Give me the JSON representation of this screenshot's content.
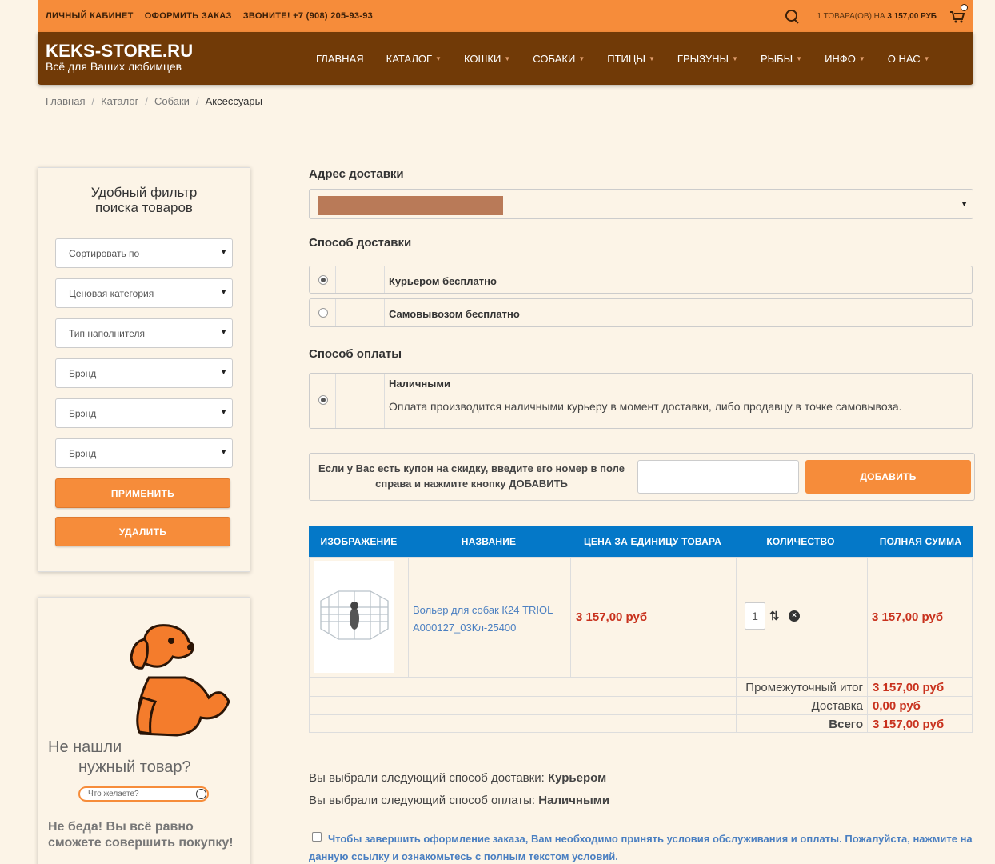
{
  "topbar": {
    "account": "Личный кабинет",
    "checkout": "Оформить заказ",
    "phone": "Звоните! +7 (908) 205-93-93",
    "cart_prefix": "1 ТОВАРА(ОВ) НА",
    "cart_total": "3 157,00 РУБ"
  },
  "header": {
    "logo": "KEKS-STORE.RU",
    "slogan": "Всё для Ваших любимцев",
    "menu": [
      "Главная",
      "Каталог",
      "Кошки",
      "Собаки",
      "Птицы",
      "Грызуны",
      "Рыбы",
      "Инфо",
      "О нас"
    ]
  },
  "breadcrumb": [
    "Главная",
    "Каталог",
    "Собаки",
    "Аксессуары"
  ],
  "filter": {
    "title_line1": "Удобный фильтр",
    "title_line2": "поиска товаров",
    "selects": [
      "Сортировать по",
      "Ценовая категория",
      "Тип наполнителя",
      "Брэнд",
      "Брэнд",
      "Брэнд"
    ],
    "apply": "ПРИМЕНИТЬ",
    "remove": "УДАЛИТЬ"
  },
  "promo": {
    "q1": "Не нашли",
    "q2": "нужный товар?",
    "search_placeholder": "Что желаете?",
    "note_line1": "Не беда! Вы всё равно",
    "note_line2": "сможете совершить покупку!"
  },
  "checkout": {
    "address_label": "Адрес доставки",
    "delivery_label": "Способ доставки",
    "delivery_options": [
      {
        "label": "Курьером бесплатно",
        "selected": true
      },
      {
        "label": "Самовывозом бесплатно",
        "selected": false
      }
    ],
    "payment_label": "Способ оплаты",
    "payment": {
      "label": "Наличными",
      "description": "Оплата производится наличными курьеру в момент доставки, либо продавцу в точке самовывоза.",
      "selected": true
    },
    "coupon_text": "Если у Вас есть купон на скидку, введите его номер в поле справа и нажмите кнопку ДОБАВИТЬ",
    "coupon_button": "ДОБАВИТЬ"
  },
  "cart_table": {
    "headers": [
      "Изображение",
      "Название",
      "Цена за единицу товара",
      "Количество",
      "Полная сумма"
    ],
    "item": {
      "name_line1": "Вольер для собак К24 TRIOL",
      "name_line2": "A000127_03Кл-25400",
      "unit_price": "3 157,00 руб",
      "quantity": "1",
      "total": "3 157,00 руб"
    },
    "summary": [
      {
        "label": "Промежуточный итог",
        "value": "3 157,00 руб",
        "bold": false
      },
      {
        "label": "Доставка",
        "value": "0,00 руб",
        "bold": false
      },
      {
        "label": "Всего",
        "value": "3 157,00 руб",
        "bold": true
      }
    ]
  },
  "chosen": {
    "delivery_prefix": "Вы выбрали следующий способ доставки:",
    "delivery_value": "Курьером",
    "payment_prefix": "Вы выбрали следующий способ оплаты:",
    "payment_value": "Наличными"
  },
  "terms": "Чтобы завершить оформление заказа, Вам необходимо принять условия обслуживания и оплаты. Пожалуйста, нажмите на данную ссылку и ознакомьтесь с полным текстом условий.",
  "colors": {
    "accent": "#f68c3a",
    "brown": "#713a07",
    "table_header": "#0478c8",
    "price": "#c8311d"
  }
}
